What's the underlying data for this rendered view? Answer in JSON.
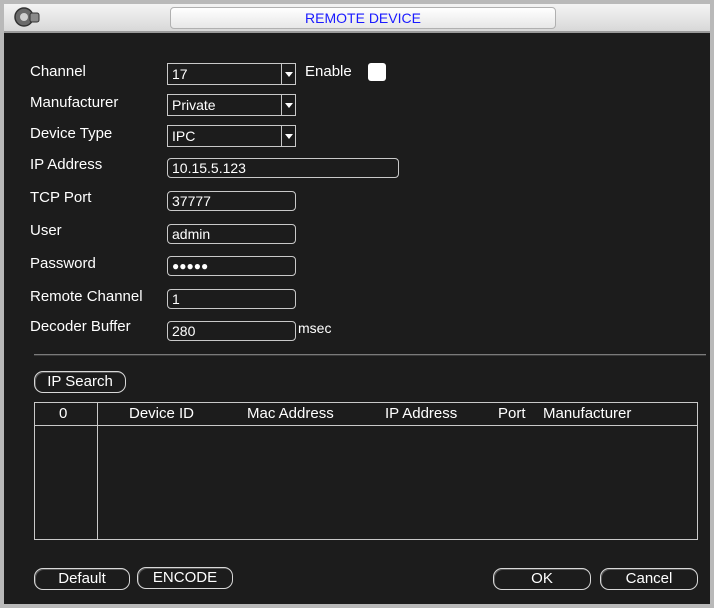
{
  "window": {
    "title": "REMOTE DEVICE",
    "icon": "network-device-icon"
  },
  "form": {
    "channel_label": "Channel",
    "channel_value": "17",
    "enable_label": "Enable",
    "manufacturer_label": "Manufacturer",
    "manufacturer_value": "Private",
    "device_type_label": "Device Type",
    "device_type_value": "IPC",
    "ip_label": "IP Address",
    "ip_value": "10.15.5.123",
    "tcp_label": "TCP Port",
    "tcp_value": "37777",
    "user_label": "User",
    "user_value": "admin",
    "password_label": "Password",
    "password_value": "●●●●●",
    "remote_channel_label": "Remote Channel",
    "remote_channel_value": "1",
    "decoder_buffer_label": "Decoder Buffer",
    "decoder_buffer_value": "280",
    "decoder_buffer_unit": "msec"
  },
  "search": {
    "button_label": "IP Search"
  },
  "table": {
    "columns": [
      "0",
      "Device ID",
      "Mac Address",
      "IP Address",
      "Port",
      "Manufacturer"
    ],
    "rows": []
  },
  "buttons": {
    "default_label": "Default",
    "encode_label": "ENCODE",
    "ok_label": "OK",
    "cancel_label": "Cancel"
  },
  "colors": {
    "title_text": "#1a1aff",
    "background": "#1c1c1c",
    "border": "#b9b9b9"
  }
}
